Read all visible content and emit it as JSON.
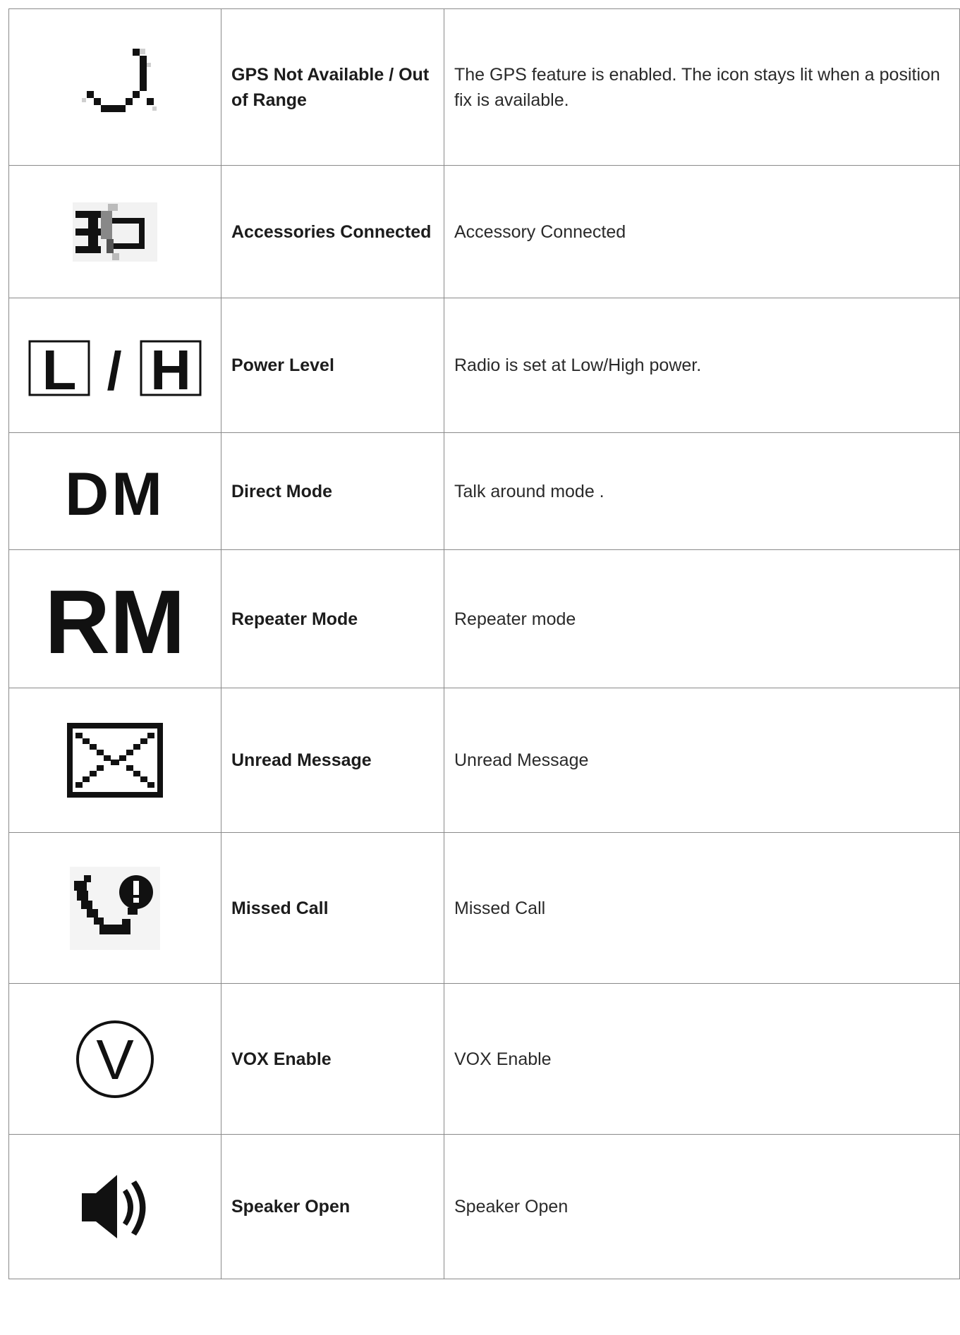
{
  "rows": [
    {
      "icon": "gps-icon",
      "name": "GPS Not Available  /  Out of Range",
      "description": "The GPS feature is enabled. The icon stays lit when a position fix is available."
    },
    {
      "icon": "accessory-icon",
      "name": "Accessories Connected",
      "description": "Accessory Connected"
    },
    {
      "icon": "power-level-icon",
      "name": "Power Level",
      "description": "Radio is set at Low/High power."
    },
    {
      "icon": "direct-mode-icon",
      "name": "Direct Mode",
      "description": "Talk around mode ."
    },
    {
      "icon": "repeater-mode-icon",
      "name": "Repeater Mode",
      "description": "Repeater mode"
    },
    {
      "icon": "envelope-icon",
      "name": "Unread Message",
      "description": "Unread Message"
    },
    {
      "icon": "missed-call-icon",
      "name": "Missed Call",
      "description": "Missed Call"
    },
    {
      "icon": "vox-icon",
      "name": "VOX Enable",
      "description": "VOX Enable"
    },
    {
      "icon": "speaker-icon",
      "name": "Speaker Open",
      "description": "Speaker Open"
    }
  ],
  "icon_glyphs": {
    "power_level": {
      "low": "L",
      "separator": "/",
      "high": "H"
    },
    "direct_mode": "DM",
    "repeater_mode": "RM",
    "vox": "V"
  }
}
